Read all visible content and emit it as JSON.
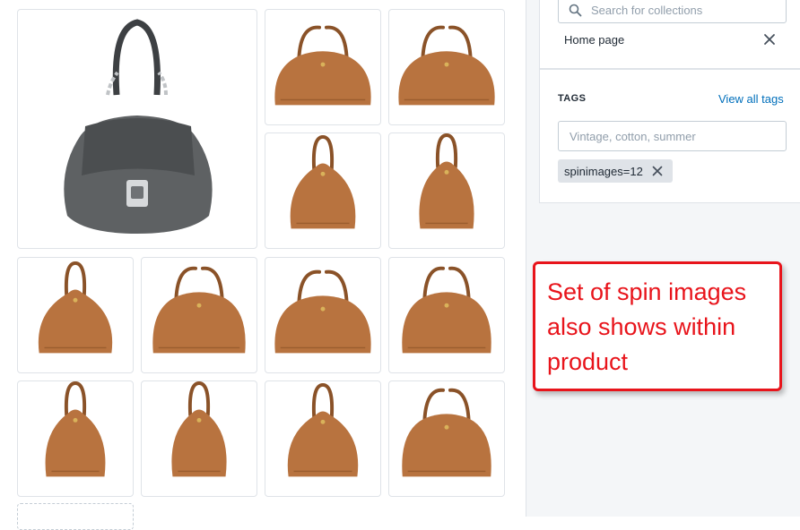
{
  "collections": {
    "search_placeholder": "Search for collections",
    "selected": [
      {
        "label": "Home page"
      }
    ]
  },
  "tags": {
    "heading": "TAGS",
    "view_all_link": "View all tags",
    "input_placeholder": "Vintage, cotton, summer",
    "items": [
      {
        "label": "spinimages=12"
      }
    ]
  },
  "callout": {
    "text": "Set of spin images also shows within product"
  },
  "media": {
    "main_image": "gray-leather-handbag",
    "spin_images": [
      "tan-handbag-angle-1",
      "tan-handbag-angle-2",
      "tan-handbag-angle-3",
      "tan-handbag-angle-4",
      "tan-handbag-angle-5",
      "tan-handbag-angle-6",
      "tan-handbag-angle-7",
      "tan-handbag-angle-8",
      "tan-handbag-angle-9",
      "tan-handbag-angle-10",
      "tan-handbag-angle-11",
      "tan-handbag-angle-12"
    ]
  },
  "colors": {
    "accent_link": "#006fbb",
    "callout_red": "#e8141b",
    "leather_tan": "#b8733f",
    "leather_gray": "#5e6163"
  }
}
